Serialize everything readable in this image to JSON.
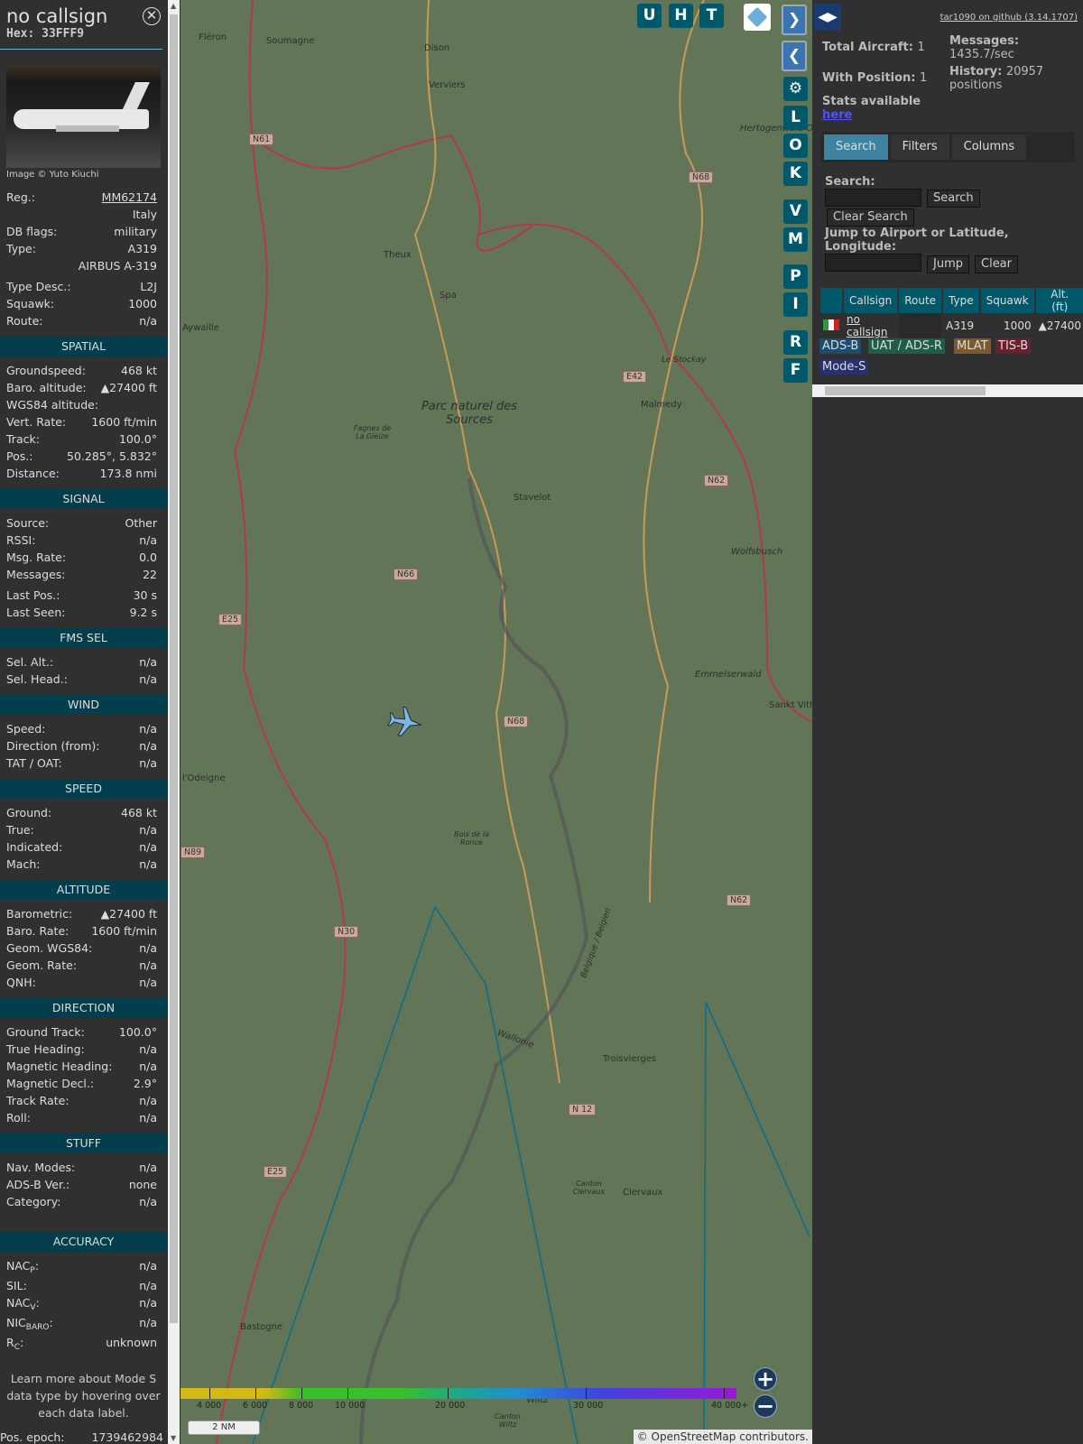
{
  "info": {
    "callsign": "no callsign",
    "hex_label": "Hex:",
    "hex": "33FFF9",
    "image_credit": "Image © Yuto Kiuchi",
    "rows_top": [
      {
        "label": "Reg.:",
        "value": "MM62174"
      },
      {
        "label": "",
        "value": "Italy"
      },
      {
        "label": "DB flags:",
        "value": "military"
      },
      {
        "label": "Type:",
        "value": "A319"
      },
      {
        "label": "",
        "value": "AIRBUS A-319"
      },
      {
        "label": "Type Desc.:",
        "value": "L2J"
      },
      {
        "label": "Squawk:",
        "value": "1000"
      },
      {
        "label": "Route:",
        "value": "n/a"
      }
    ],
    "sections": [
      {
        "title": "SPATIAL",
        "rows": [
          [
            "Groundspeed:",
            "468 kt"
          ],
          [
            "Baro. altitude:",
            "▲27400 ft"
          ],
          [
            "WGS84 altitude:",
            ""
          ],
          [
            "Vert. Rate:",
            "1600 ft/min"
          ],
          [
            "Track:",
            "100.0°"
          ],
          [
            "Pos.:",
            "50.285°, 5.832°"
          ],
          [
            "Distance:",
            "173.8 nmi"
          ]
        ]
      },
      {
        "title": "SIGNAL",
        "rows": [
          [
            "Source:",
            "Other"
          ],
          [
            "RSSI:",
            "n/a"
          ],
          [
            "Msg. Rate:",
            "0.0"
          ],
          [
            "Messages:",
            "22"
          ],
          [
            "Last Pos.:",
            "30 s"
          ],
          [
            "Last Seen:",
            "9.2 s"
          ]
        ]
      },
      {
        "title": "FMS SEL",
        "rows": [
          [
            "Sel. Alt.:",
            "n/a"
          ],
          [
            "Sel. Head.:",
            "n/a"
          ]
        ]
      },
      {
        "title": "WIND",
        "rows": [
          [
            "Speed:",
            "n/a"
          ],
          [
            "Direction (from):",
            "n/a"
          ],
          [
            "TAT / OAT:",
            "n/a"
          ]
        ]
      },
      {
        "title": "SPEED",
        "rows": [
          [
            "Ground:",
            "468 kt"
          ],
          [
            "True:",
            "n/a"
          ],
          [
            "Indicated:",
            "n/a"
          ],
          [
            "Mach:",
            "n/a"
          ]
        ]
      },
      {
        "title": "ALTITUDE",
        "rows": [
          [
            "Barometric:",
            "▲27400 ft"
          ],
          [
            "Baro. Rate:",
            "1600 ft/min"
          ],
          [
            "Geom. WGS84:",
            "n/a"
          ],
          [
            "Geom. Rate:",
            "n/a"
          ],
          [
            "QNH:",
            "n/a"
          ]
        ]
      },
      {
        "title": "DIRECTION",
        "rows": [
          [
            "Ground Track:",
            "100.0°"
          ],
          [
            "True Heading:",
            "n/a"
          ],
          [
            "Magnetic Heading:",
            "n/a"
          ],
          [
            "Magnetic Decl.:",
            "2.9°"
          ],
          [
            "Track Rate:",
            "n/a"
          ],
          [
            "Roll:",
            "n/a"
          ]
        ]
      },
      {
        "title": "STUFF",
        "rows": [
          [
            "Nav. Modes:",
            "n/a"
          ],
          [
            "ADS-B Ver.:",
            "none"
          ],
          [
            "Category:",
            "n/a"
          ]
        ]
      }
    ],
    "accuracy": {
      "title": "ACCURACY",
      "nacp": "NAC",
      "nacp_sub": "P",
      "nacp_v": "n/a",
      "sil": "SIL:",
      "sil_v": "n/a",
      "nacv": "NAC",
      "nacv_sub": "V",
      "nacv_v": "n/a",
      "nic": "NIC",
      "nic_sub": "BARO",
      "nic_v": "n/a",
      "rc": "R",
      "rc_sub": "C",
      "rc_v": "unknown"
    },
    "learn_more": "Learn more about Mode S data type by hovering over each data label.",
    "pos_epoch_label": "Pos. epoch:",
    "pos_epoch": "1739462984"
  },
  "map": {
    "top_buttons": [
      "U",
      "H",
      "T"
    ],
    "side_buttons": [
      "L",
      "O",
      "K",
      "V",
      "M",
      "P",
      "I",
      "R",
      "F"
    ],
    "labels": [
      "Fléron",
      "Soumagne",
      "Dison",
      "Verviers",
      "Theux",
      "Spa",
      "Aywaille",
      "Malmedy",
      "Stavelot",
      "Wolfsbusch",
      "Emmelserwald",
      "Sankt Vith",
      "l'Odeigne",
      "Troisvierges",
      "Clervaux",
      "Bastogne",
      "Wiltz",
      "Wallonie",
      "Le Stockay",
      "Belgique / Belgien"
    ],
    "italic_labels": [
      "Hertogenwald Occidental",
      "Fagnes de La Gleize",
      "Bois de la Ronce",
      "Canton Clervaux",
      "Canton Wiltz"
    ],
    "park": "Parc naturel des Sources",
    "roads": [
      "N61",
      "N68",
      "E42",
      "N62",
      "N66",
      "E25",
      "N68",
      "N89",
      "N62",
      "N30",
      "N 12",
      "E25"
    ],
    "colorbar_ticks": [
      "4 000",
      "6 000",
      "8 000",
      "10 000",
      "20 000",
      "30 000",
      "40 000+"
    ],
    "scale": "2 NM",
    "attribution_prefix": "©",
    "attribution_link": "OpenStreetMap",
    "attribution_suffix": "contributors."
  },
  "panel": {
    "github": "tar1090 on github (3.14.1707)",
    "total_label": "Total Aircraft:",
    "total": "1",
    "withpos_label": "With Position:",
    "withpos": "1",
    "stats_label": "Stats available",
    "stats_link": "here",
    "messages_label": "Messages:",
    "messages": "1435.7/sec",
    "history_label": "History:",
    "history": "20957 positions",
    "tabs": [
      "Search",
      "Filters",
      "Columns"
    ],
    "search_label": "Search:",
    "search_value": "",
    "search_btn": "Search",
    "clear_search_btn": "Clear Search",
    "jump_label": "Jump to Airport or Latitude, Longitude:",
    "jump_value": "",
    "jump_btn": "Jump",
    "clear_btn": "Clear",
    "columns": [
      "",
      "Callsign",
      "Route",
      "Type",
      "Squawk",
      "Alt. (ft)"
    ],
    "rows": [
      {
        "callsign": "no callsign",
        "route": "",
        "type": "A319",
        "squawk": "1000",
        "alt": "▲27400"
      }
    ],
    "sources": [
      {
        "label": "ADS-B",
        "color": "#1b4e6e"
      },
      {
        "label": "UAT / ADS-R",
        "color": "#1e5e48"
      },
      {
        "label": "MLAT",
        "color": "#7a5a2e"
      },
      {
        "label": "TIS-B",
        "color": "#6a2030"
      },
      {
        "label": "Mode-S",
        "color": "#283070"
      }
    ]
  }
}
